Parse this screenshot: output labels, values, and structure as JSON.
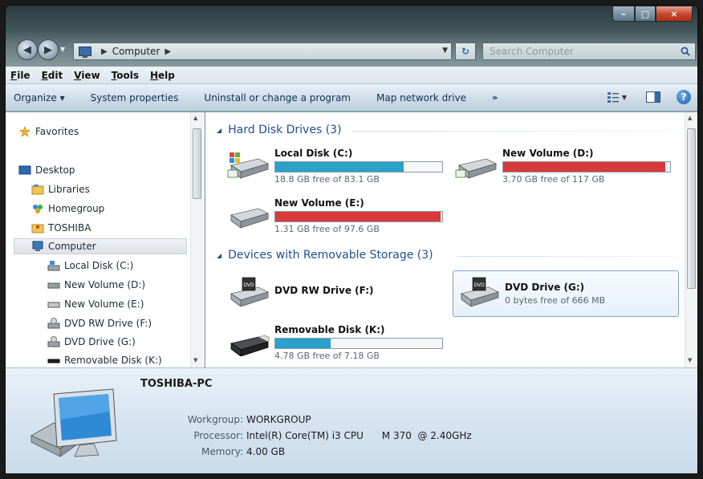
{
  "window": {
    "controls": {
      "minimize": "–",
      "maximize": "□",
      "close": "×"
    }
  },
  "navigation": {
    "back_glyph": "◀",
    "forward_glyph": "▶",
    "address_crumb": "Computer",
    "refresh_glyph": "↻",
    "search_placeholder": "Search Computer"
  },
  "menu": [
    {
      "accel": "F",
      "rest": "ile"
    },
    {
      "accel": "E",
      "rest": "dit"
    },
    {
      "accel": "V",
      "rest": "iew"
    },
    {
      "accel": "T",
      "rest": "ools"
    },
    {
      "accel": "H",
      "rest": "elp"
    }
  ],
  "toolbar": {
    "organize": "Organize ▾",
    "system_properties": "System properties",
    "uninstall": "Uninstall or change a program",
    "map_drive": "Map network drive",
    "more": "»",
    "help": "?"
  },
  "sidebar": {
    "items": [
      {
        "label": "Favorites",
        "icon": "star-icon"
      },
      {
        "label": "Desktop",
        "icon": "desktop-icon"
      },
      {
        "label": "Libraries",
        "icon": "libraries-icon"
      },
      {
        "label": "Homegroup",
        "icon": "homegroup-icon"
      },
      {
        "label": "TOSHIBA",
        "icon": "user-folder-icon"
      },
      {
        "label": "Computer",
        "icon": "computer-icon"
      },
      {
        "label": "Local Disk (C:)",
        "icon": "system-drive-icon"
      },
      {
        "label": "New Volume (D:)",
        "icon": "drive-icon"
      },
      {
        "label": "New Volume (E:)",
        "icon": "drive-icon"
      },
      {
        "label": "DVD RW Drive (F:)",
        "icon": "dvd-drive-icon"
      },
      {
        "label": "DVD Drive (G:)",
        "icon": "dvd-drive-icon"
      },
      {
        "label": "Removable Disk (K:)",
        "icon": "removable-disk-icon"
      }
    ]
  },
  "groups": {
    "hard_disks": "Hard Disk Drives (3)",
    "removable": "Devices with Removable Storage (3)"
  },
  "drives": {
    "c": {
      "name": "Local Disk (C:)",
      "free": "18.8 GB free of 83.1 GB",
      "used_fraction": 0.77,
      "bar_color": "#2aa1c9"
    },
    "d": {
      "name": "New Volume (D:)",
      "free": "3.70 GB free of 117 GB",
      "used_fraction": 0.97,
      "bar_color": "#d8393b"
    },
    "e": {
      "name": "New Volume (E:)",
      "free": "1.31 GB free of 97.6 GB",
      "used_fraction": 0.99,
      "bar_color": "#d8393b"
    },
    "f": {
      "name": "DVD RW Drive (F:)"
    },
    "g": {
      "name": "DVD Drive (G:)",
      "free": "0 bytes free of 666 MB"
    },
    "k": {
      "name": "Removable Disk (K:)",
      "free": "4.78 GB free of 7.18 GB",
      "used_fraction": 0.33,
      "bar_color": "#2aa1c9"
    }
  },
  "details": {
    "pc_name": "TOSHIBA-PC",
    "workgroup_label": "Workgroup:",
    "workgroup": "WORKGROUP",
    "processor_label": "Processor:",
    "processor": "Intel(R) Core(TM) i3 CPU      M 370  @ 2.40GHz",
    "memory_label": "Memory:",
    "memory": "4.00 GB"
  }
}
